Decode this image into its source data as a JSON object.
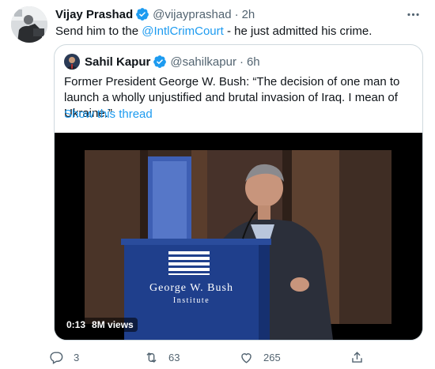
{
  "tweet": {
    "author_name": "Vijay Prashad",
    "handle": "@vijayprashad",
    "separator": "·",
    "time": "2h",
    "text_before": "Send him to the ",
    "mention": "@IntlCrimCourt",
    "text_after": " - he just admitted his crime."
  },
  "quoted": {
    "author_name": "Sahil Kapur",
    "handle": "@sahilkapur",
    "separator": "·",
    "time": "6h",
    "text": "Former President George W. Bush: “The decision of one man to launch a wholly unjustified and brutal invasion of Iraq. I mean of Ukraine.”",
    "show_thread": "Show this thread",
    "video": {
      "duration": "0:13",
      "views": "8M views",
      "podium_line1": "George W. Bush",
      "podium_line2": "Institute"
    }
  },
  "actions": {
    "replies": "3",
    "retweets": "63",
    "likes": "265"
  },
  "colors": {
    "accent": "#1d9bf0",
    "text": "#0f1419",
    "secondary": "#536471",
    "podium": "#1f3f8c"
  },
  "icons": [
    "verified-badge-icon",
    "more-icon",
    "reply-icon",
    "retweet-icon",
    "like-icon",
    "share-icon"
  ]
}
